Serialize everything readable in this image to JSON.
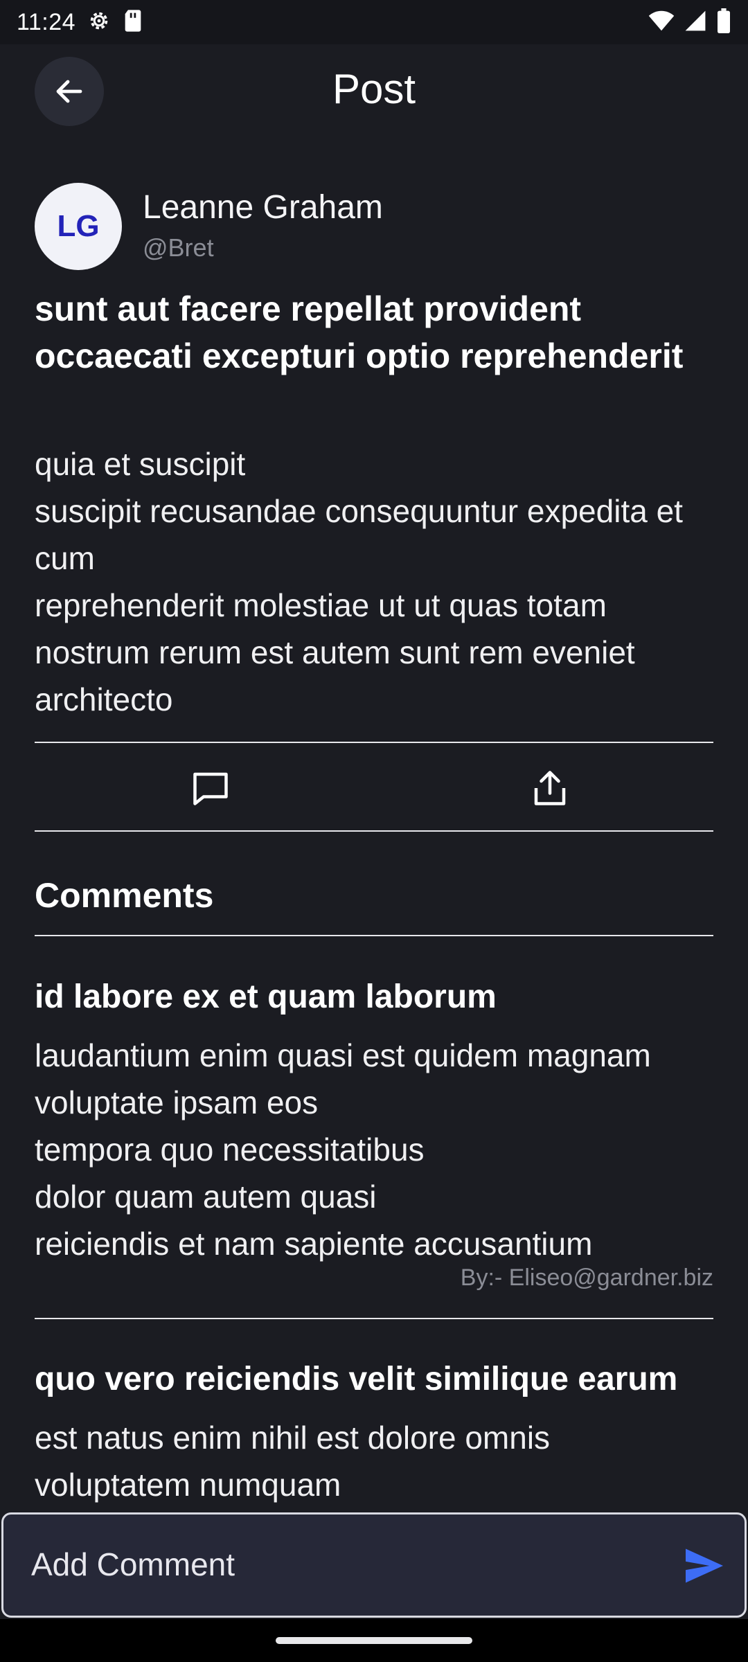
{
  "status_bar": {
    "time": "11:24",
    "icons": [
      "settings-icon",
      "sim-card-icon",
      "wifi-icon",
      "signal-icon",
      "battery-icon"
    ]
  },
  "header": {
    "title": "Post",
    "back_icon": "arrow-left-icon"
  },
  "post": {
    "author": {
      "initials": "LG",
      "name": "Leanne Graham",
      "handle": "@Bret"
    },
    "title": "sunt aut facere repellat provident occaecati excepturi optio reprehenderit",
    "body": "quia et suscipit\nsuscipit recusandae consequuntur expedita et cum\nreprehenderit molestiae ut ut quas totam\nnostrum rerum est autem sunt rem eveniet architecto",
    "actions": [
      "comment-icon",
      "share-icon"
    ]
  },
  "comments_section": {
    "heading": "Comments",
    "items": [
      {
        "title": "id labore ex et quam laborum",
        "body": "laudantium enim quasi est quidem magnam voluptate ipsam eos\ntempora quo necessitatibus\ndolor quam autem quasi\nreiciendis et nam sapiente accusantium",
        "author": "By:- Eliseo@gardner.biz"
      },
      {
        "title": "quo vero reiciendis velit similique earum",
        "body": "est natus enim nihil est dolore omnis voluptatem numquam",
        "author": ""
      }
    ]
  },
  "comment_input": {
    "placeholder": "Add Comment",
    "send_icon": "send-icon"
  },
  "colors": {
    "background": "#1b1c22",
    "avatar_bg": "#f1f2f8",
    "avatar_text": "#2323b8",
    "send_accent": "#3d6df5",
    "muted_text": "#8b8d96"
  }
}
